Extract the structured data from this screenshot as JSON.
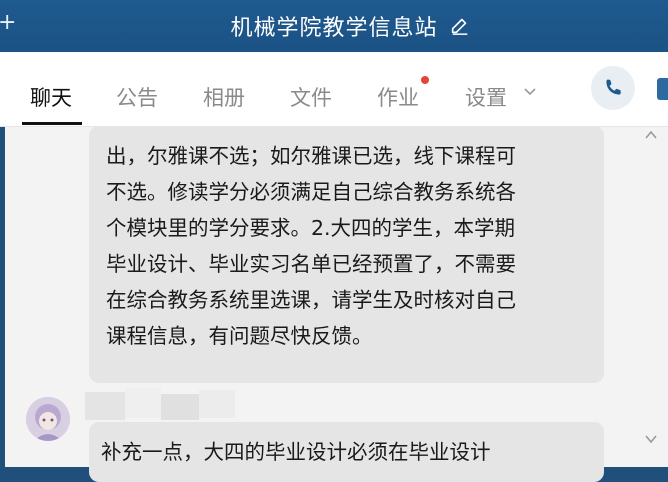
{
  "window": {
    "title": "机械学院教学信息站",
    "plus_glyph": "+"
  },
  "tabs": [
    {
      "label": "聊天",
      "active": true
    },
    {
      "label": "公告",
      "active": false
    },
    {
      "label": "相册",
      "active": false
    },
    {
      "label": "文件",
      "active": false
    },
    {
      "label": "作业",
      "active": false,
      "has_notification_dot": true
    },
    {
      "label": "设置",
      "active": false,
      "has_dropdown": true
    }
  ],
  "messages": [
    {
      "lines": [
        "出，尔雅课不选；如尔雅课已选，线下课程可",
        "不选。修读学分必须满足自己综合教务系统各",
        "个模块里的学分要求。2.大四的学生，本学期",
        "毕业设计、毕业实习名单已经预置了，不需要",
        "在综合教务系统里选课，请学生及时核对自己",
        "课程信息，有问题尽快反馈。"
      ]
    },
    {
      "partial_line": "补充一点，大四的毕业设计必须在毕业设计"
    }
  ],
  "icons": {
    "edit": "edit-pencil-icon",
    "call": "phone-icon",
    "dropdown": "chevron-down-icon",
    "scroll_up": "chevron-up-icon",
    "scroll_down": "chevron-down-icon"
  },
  "colors": {
    "titlebar": "#1e5a8e",
    "bubble": "#e5e5e5",
    "notification_dot": "#e8433a",
    "call_icon": "#1e5a8e"
  }
}
